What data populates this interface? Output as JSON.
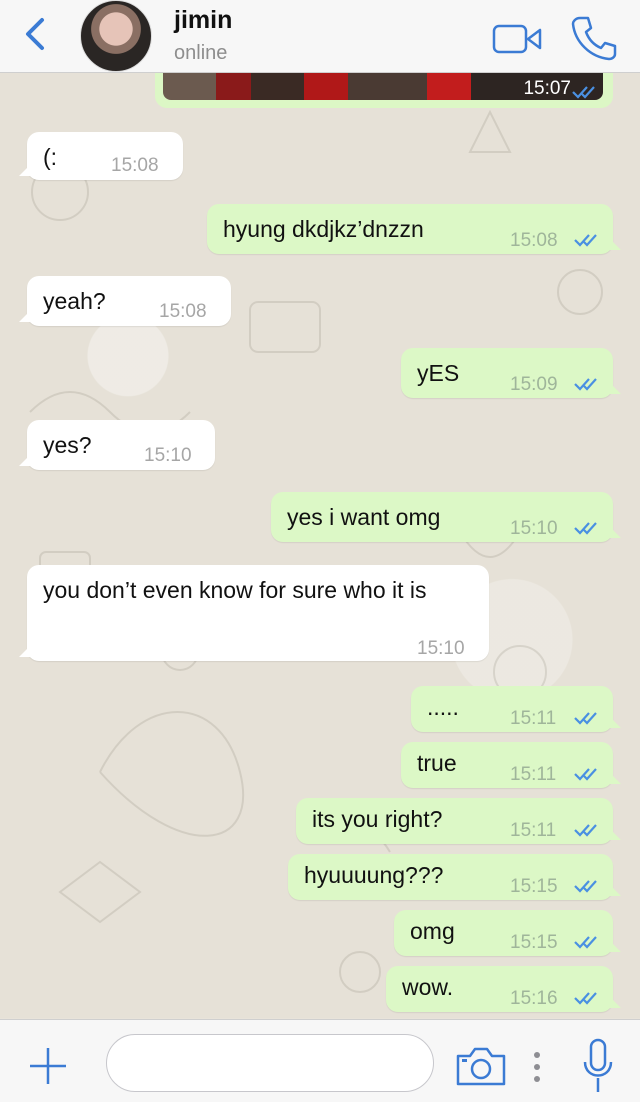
{
  "header": {
    "contact_name": "jimin",
    "status": "online",
    "accent": "#3b7bd4"
  },
  "messages": [
    {
      "dir": "out",
      "text": "",
      "time": "15:07",
      "ticks": "read",
      "is_image": true
    },
    {
      "dir": "in",
      "text": "(:",
      "time": "15:08"
    },
    {
      "dir": "out",
      "text": "hyung dkdjkz’dnzzn",
      "time": "15:08",
      "ticks": "read"
    },
    {
      "dir": "in",
      "text": "yeah?",
      "time": "15:08"
    },
    {
      "dir": "out",
      "text": "yES",
      "time": "15:09",
      "ticks": "read"
    },
    {
      "dir": "in",
      "text": "yes?",
      "time": "15:10"
    },
    {
      "dir": "out",
      "text": "yes i want omg",
      "time": "15:10",
      "ticks": "read"
    },
    {
      "dir": "in",
      "text": "you don’t even know for sure who it is",
      "time": "15:10"
    },
    {
      "dir": "out",
      "text": ".....",
      "time": "15:11",
      "ticks": "read"
    },
    {
      "dir": "out",
      "text": "true",
      "time": "15:11",
      "ticks": "read"
    },
    {
      "dir": "out",
      "text": "its you right?",
      "time": "15:11",
      "ticks": "read"
    },
    {
      "dir": "out",
      "text": "hyuuuung???",
      "time": "15:15",
      "ticks": "read"
    },
    {
      "dir": "out",
      "text": "omg",
      "time": "15:15",
      "ticks": "read"
    },
    {
      "dir": "out",
      "text": "wow.",
      "time": "15:16",
      "ticks": "read"
    }
  ],
  "input": {
    "placeholder": "",
    "value": ""
  },
  "icons": {
    "back": "chevron-left-icon",
    "video": "video-camera-icon",
    "call": "phone-icon",
    "plus": "plus-icon",
    "camera": "camera-icon",
    "more": "more-vertical-icon",
    "mic": "microphone-icon"
  },
  "colors": {
    "incoming_bubble": "#ffffff",
    "outgoing_bubble": "#dcf8c6",
    "read_ticks": "#4a90e2",
    "chat_background": "#e6e1d7"
  }
}
